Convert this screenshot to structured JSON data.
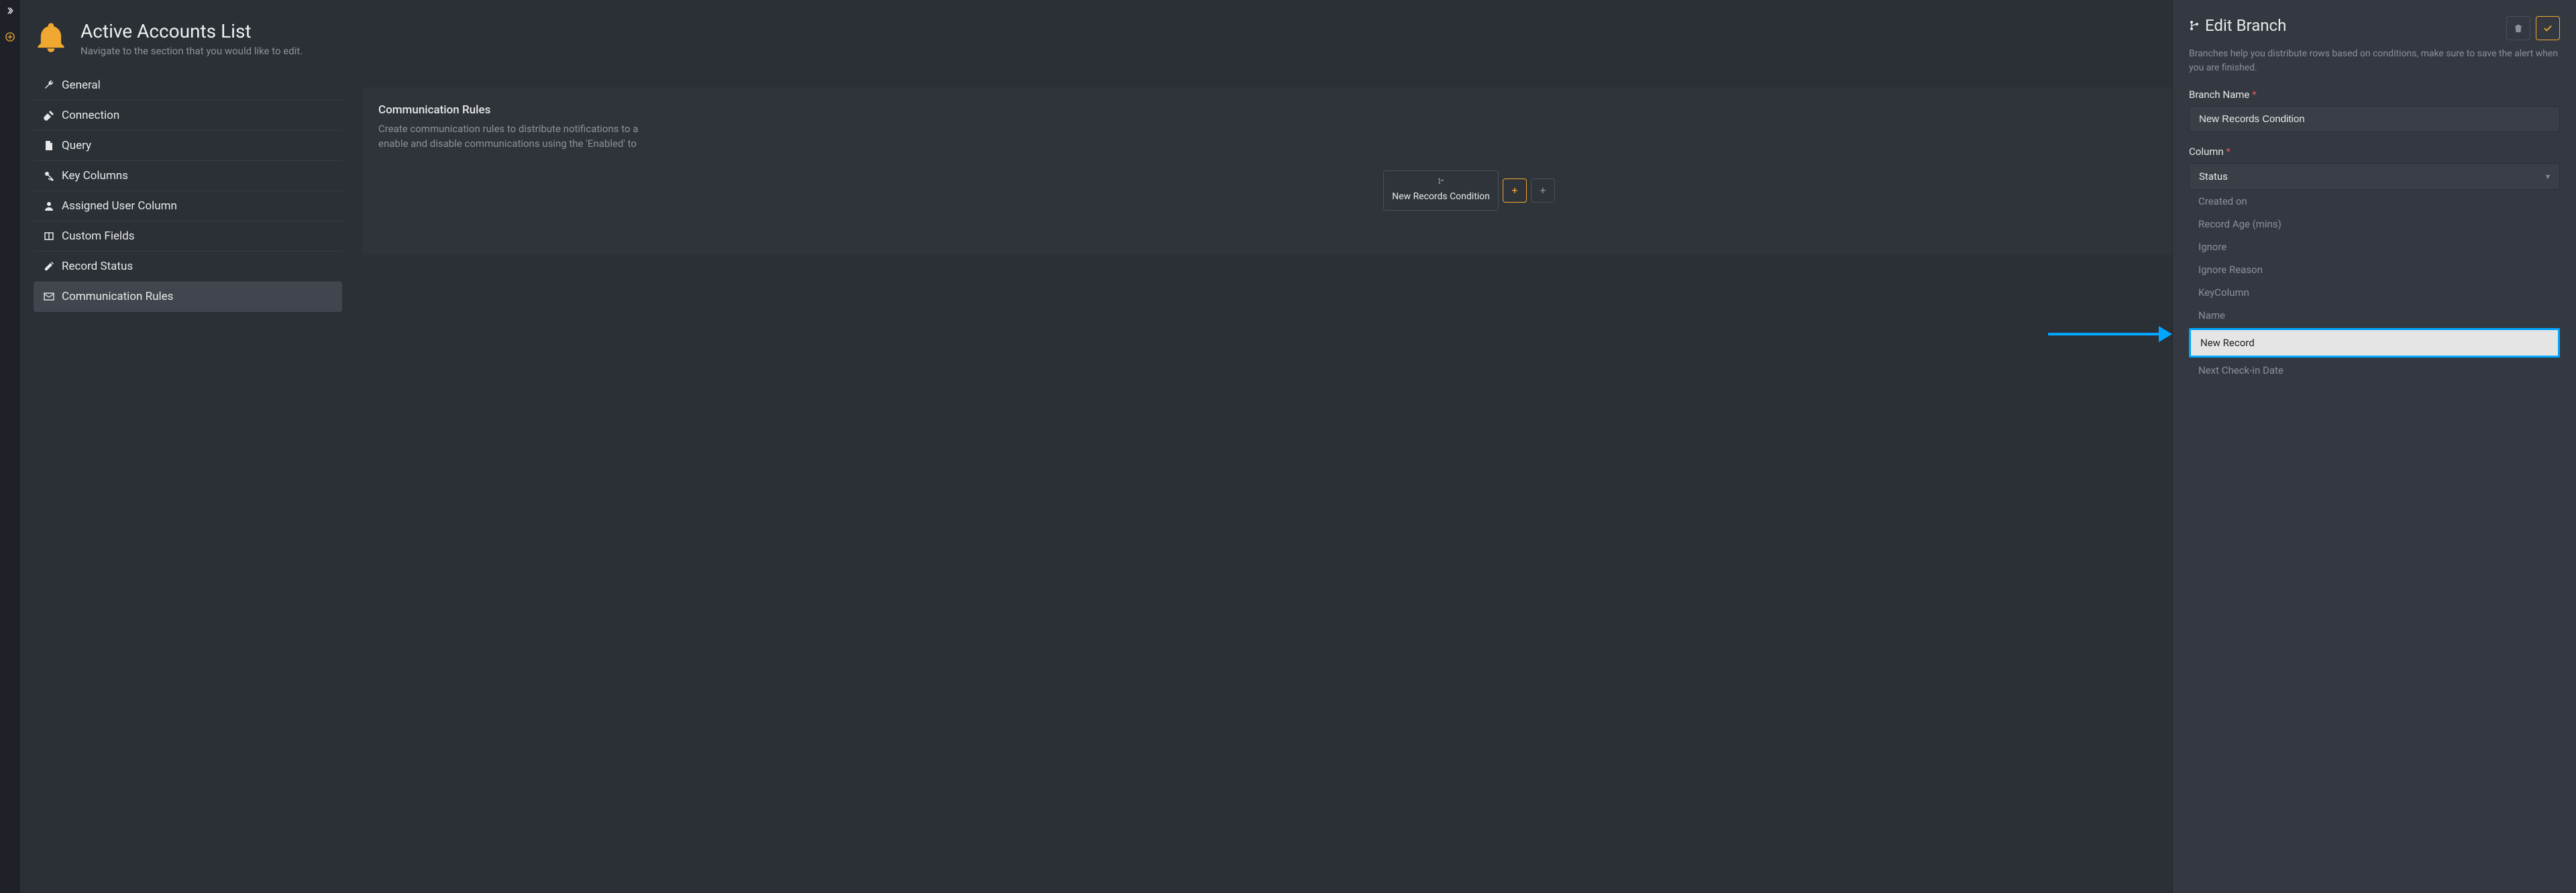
{
  "sidebar": {
    "expand_label": "Expand",
    "add_label": "Add"
  },
  "header": {
    "title": "Active Accounts List",
    "subtitle": "Navigate to the section that you would like to edit."
  },
  "nav": [
    {
      "label": "General",
      "icon": "wrench"
    },
    {
      "label": "Connection",
      "icon": "plug"
    },
    {
      "label": "Query",
      "icon": "file"
    },
    {
      "label": "Key Columns",
      "icon": "key"
    },
    {
      "label": "Assigned User Column",
      "icon": "user"
    },
    {
      "label": "Custom Fields",
      "icon": "columns"
    },
    {
      "label": "Record Status",
      "icon": "edit"
    },
    {
      "label": "Communication Rules",
      "icon": "envelope",
      "active": true
    }
  ],
  "panel": {
    "title": "Communication Rules",
    "desc_line1": "Create communication rules to distribute notifications to a",
    "desc_line2": "enable and disable communications using the 'Enabled' to",
    "branch_label": "New Records Condition",
    "add_branch_label": "+",
    "add_branch2_label": "+"
  },
  "drawer": {
    "title": "Edit Branch",
    "desc": "Branches help you distribute rows based on conditions, make sure to save the alert when you are finished.",
    "delete_label": "Delete",
    "confirm_label": "Confirm",
    "fields": {
      "branch_name": {
        "label": "Branch Name",
        "value": "New Records Condition"
      },
      "column": {
        "label": "Column",
        "value": "Status"
      }
    },
    "options": [
      {
        "label": "Created on"
      },
      {
        "label": "Record Age (mins)"
      },
      {
        "label": "Ignore"
      },
      {
        "label": "Ignore Reason"
      },
      {
        "label": "KeyColumn"
      },
      {
        "label": "Name"
      },
      {
        "label": "New Record",
        "highlight": true
      },
      {
        "label": "Next Check-in Date"
      }
    ]
  }
}
